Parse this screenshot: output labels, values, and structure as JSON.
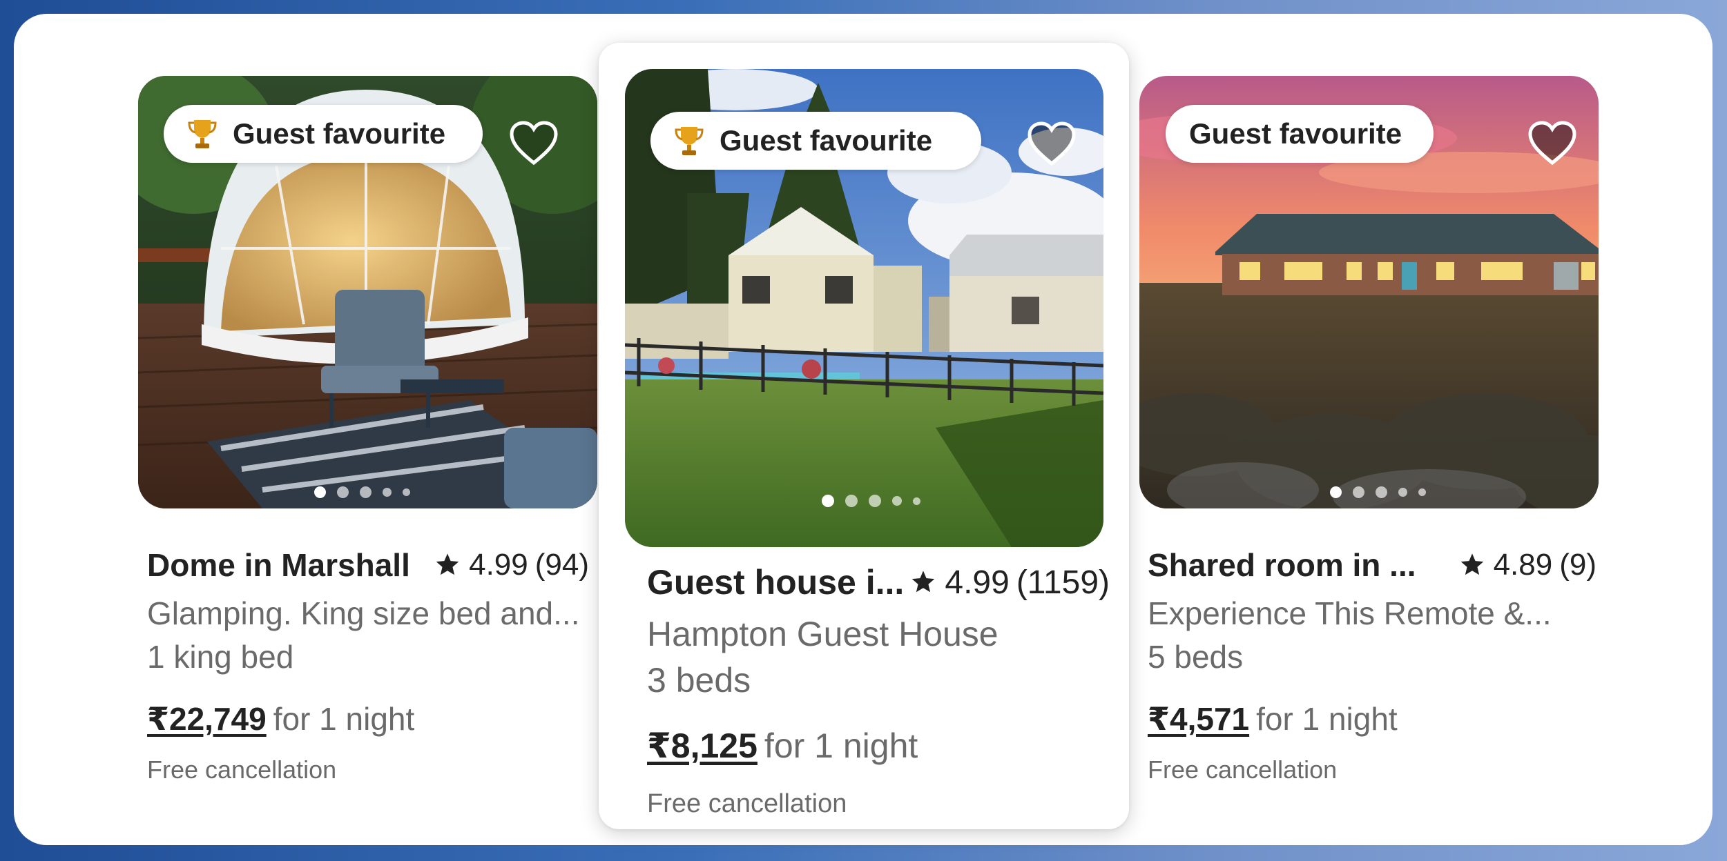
{
  "listings": [
    {
      "badge_label": "Guest favourite",
      "badge_icon": "trophy-icon",
      "show_trophy": true,
      "title": "Dome in Marshall",
      "rating": "4.99",
      "review_count": "(94)",
      "description": "Glamping. King size bed and...",
      "beds": "1 king bed",
      "price": "₹22,749",
      "price_suffix": "for 1 night",
      "cancellation": "Free cancellation",
      "photo_count": 5,
      "active_photo": 1
    },
    {
      "badge_label": "Guest favourite",
      "badge_icon": "trophy-icon",
      "show_trophy": true,
      "title": "Guest house i...",
      "rating": "4.99",
      "review_count": "(1159)",
      "description": "Hampton Guest House",
      "beds": "3 beds",
      "price": "₹8,125",
      "price_suffix": "for 1 night",
      "cancellation": "Free cancellation",
      "photo_count": 5,
      "active_photo": 1
    },
    {
      "badge_label": "Guest favourite",
      "show_trophy": false,
      "title": "Shared room in ...",
      "rating": "4.89",
      "review_count": "(9)",
      "description": "Experience This Remote &...",
      "beds": "5 beds",
      "price": "₹4,571",
      "price_suffix": "for 1 night",
      "cancellation": "Free cancellation",
      "photo_count": 5,
      "active_photo": 1
    }
  ],
  "colors": {
    "text_primary": "#222222",
    "text_secondary": "#6a6a6a",
    "background_gradient_start": "#1f4d96",
    "background_gradient_end": "#8aa7d8"
  }
}
